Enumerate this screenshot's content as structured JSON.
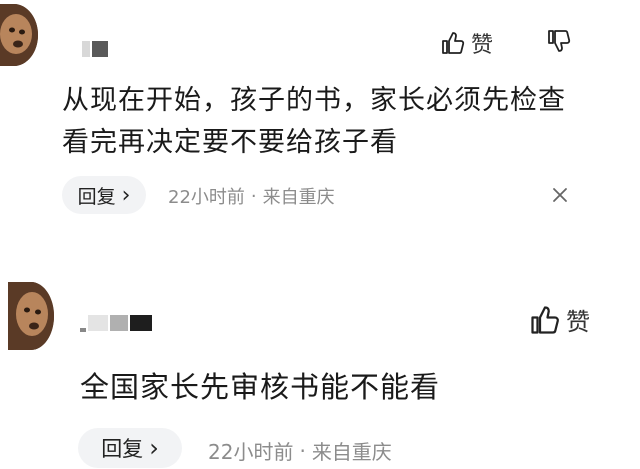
{
  "comments": [
    {
      "text": "从现在开始，孩子的书，家长必须先检查\n看完再决定要不要给孩子看",
      "like_label": "赞",
      "reply_label": "回复",
      "reply_chevron": "›",
      "time": "22小时前",
      "separator": "·",
      "location": "来自重庆",
      "icons": [
        "avatar",
        "thumbs-up-icon",
        "thumbs-down-icon",
        "close-icon"
      ]
    },
    {
      "text": "全国家长先审核书能不能看",
      "like_label": "赞",
      "reply_label": "回复",
      "reply_chevron": "›",
      "time": "22小时前",
      "separator": "·",
      "location": "来自重庆",
      "icons": [
        "avatar",
        "thumbs-up-icon"
      ]
    }
  ],
  "colors": {
    "text": "#1a1a1a",
    "meta": "#8c8c8c",
    "reply_bg": "#f2f3f5"
  }
}
